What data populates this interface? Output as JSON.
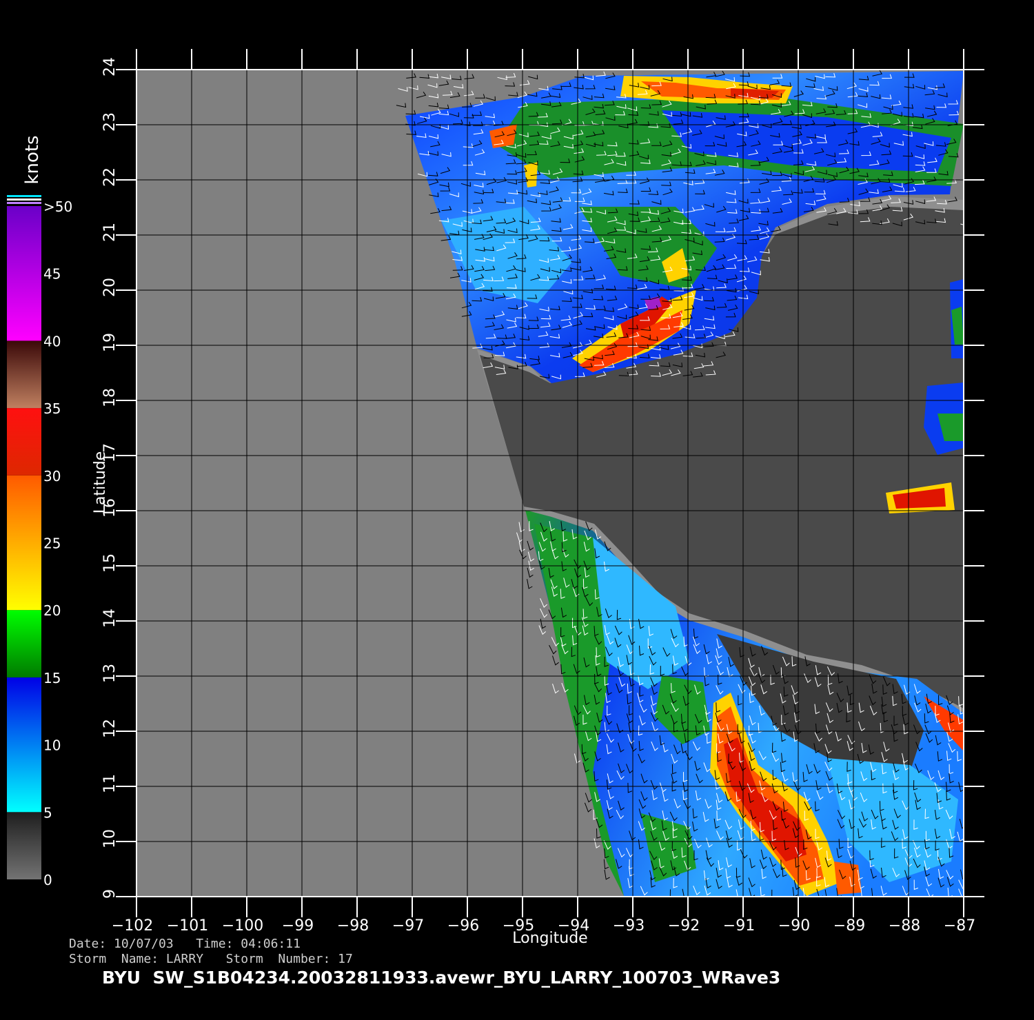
{
  "colors": {
    "background": "#000000",
    "land": "#4a4a4a",
    "coast_band": "#8f8f8f",
    "no_data": "#808080",
    "grid": "#000000",
    "axis": "#ffffff"
  },
  "chart_data": {
    "type": "heatmap",
    "title": "BYU  SW_S1B04234.20032811933.avewr_BYU_LARRY_100703_WRave3",
    "xlabel": "Longitude",
    "ylabel": "Latitude",
    "xlim": [
      -102,
      -87
    ],
    "ylim": [
      9,
      24
    ],
    "x_ticks": [
      "−102",
      "−101",
      "−100",
      "−99",
      "−98",
      "−97",
      "−96",
      "−95",
      "−94",
      "−93",
      "−92",
      "−91",
      "−90",
      "−89",
      "−88",
      "−87"
    ],
    "y_ticks": [
      "9",
      "10",
      "11",
      "12",
      "13",
      "14",
      "15",
      "16",
      "17",
      "18",
      "19",
      "20",
      "21",
      "22",
      "23",
      "24"
    ],
    "grid": true,
    "colorbar": {
      "title": "knots",
      "range": [
        0,
        50
      ],
      "tick_labels": [
        ">50",
        "45",
        "40",
        "35",
        "30",
        "25",
        "20",
        "15",
        "10",
        "5",
        "0"
      ],
      "bands": [
        {
          "range": [
            0,
            5
          ],
          "colors": [
            "#737373",
            "#1e1e1e"
          ]
        },
        {
          "range": [
            5,
            15
          ],
          "colors": [
            "#00ffff",
            "#0000e6"
          ]
        },
        {
          "range": [
            15,
            20
          ],
          "colors": [
            "#007a00",
            "#00ff00"
          ]
        },
        {
          "range": [
            20,
            30
          ],
          "colors": [
            "#ffff00",
            "#ff5a00"
          ]
        },
        {
          "range": [
            30,
            35
          ],
          "colors": [
            "#dd2800",
            "#ff1010"
          ]
        },
        {
          "range": [
            35,
            40
          ],
          "colors": [
            "#c08060",
            "#3a0808"
          ]
        },
        {
          "range": [
            40,
            50
          ],
          "colors": [
            "#ff00ff",
            "#6a00c8"
          ]
        }
      ]
    }
  },
  "info": {
    "line1": "Date: 10/07/03   Time: 04:06:11",
    "line2": "Storm  Name: LARRY   Storm  Number: 17"
  }
}
